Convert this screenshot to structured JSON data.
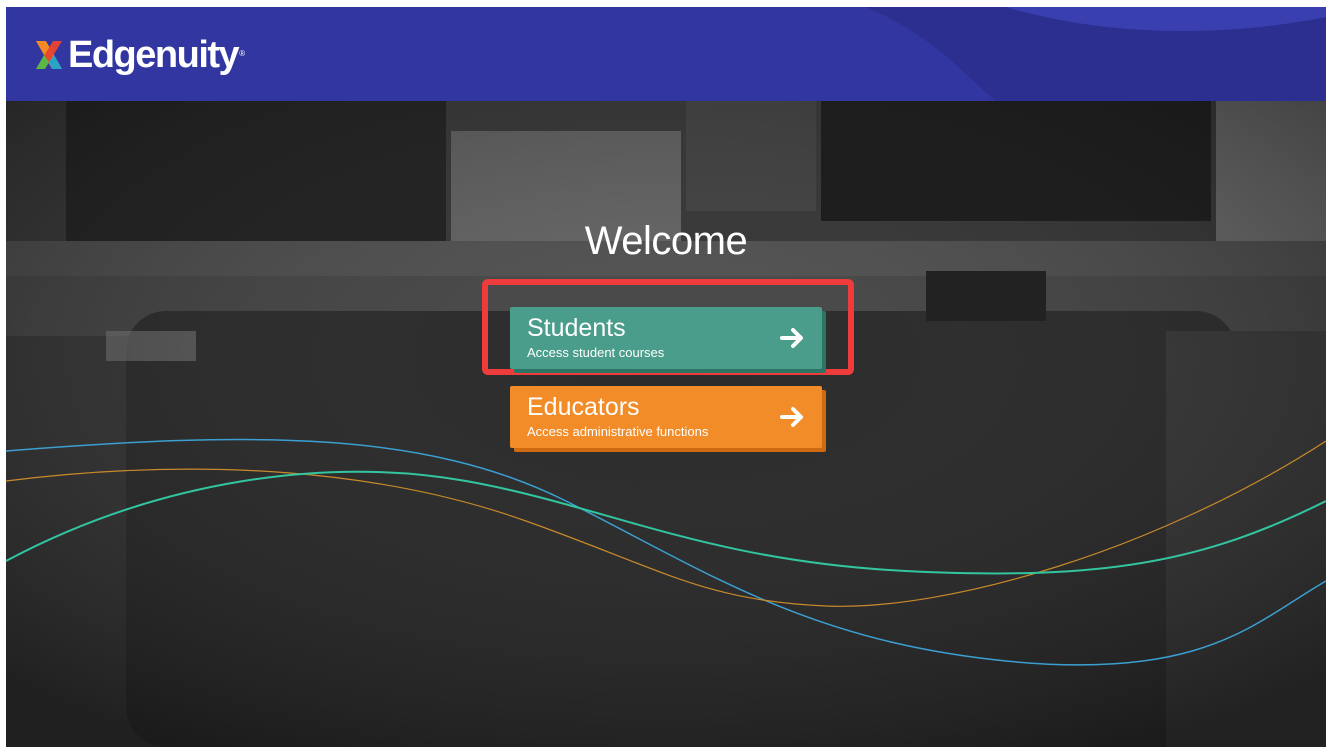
{
  "header": {
    "brand": "Edgenuity",
    "registered": "®",
    "color": "#3236a0"
  },
  "hero": {
    "welcome": "Welcome"
  },
  "cards": {
    "students": {
      "title": "Students",
      "subtitle": "Access student courses",
      "color": "#4a9d8a",
      "icon": "arrow-right-icon"
    },
    "educators": {
      "title": "Educators",
      "subtitle": "Access administrative functions",
      "color": "#f28c28",
      "icon": "arrow-right-icon"
    }
  },
  "highlight_color": "#ee3c3c"
}
